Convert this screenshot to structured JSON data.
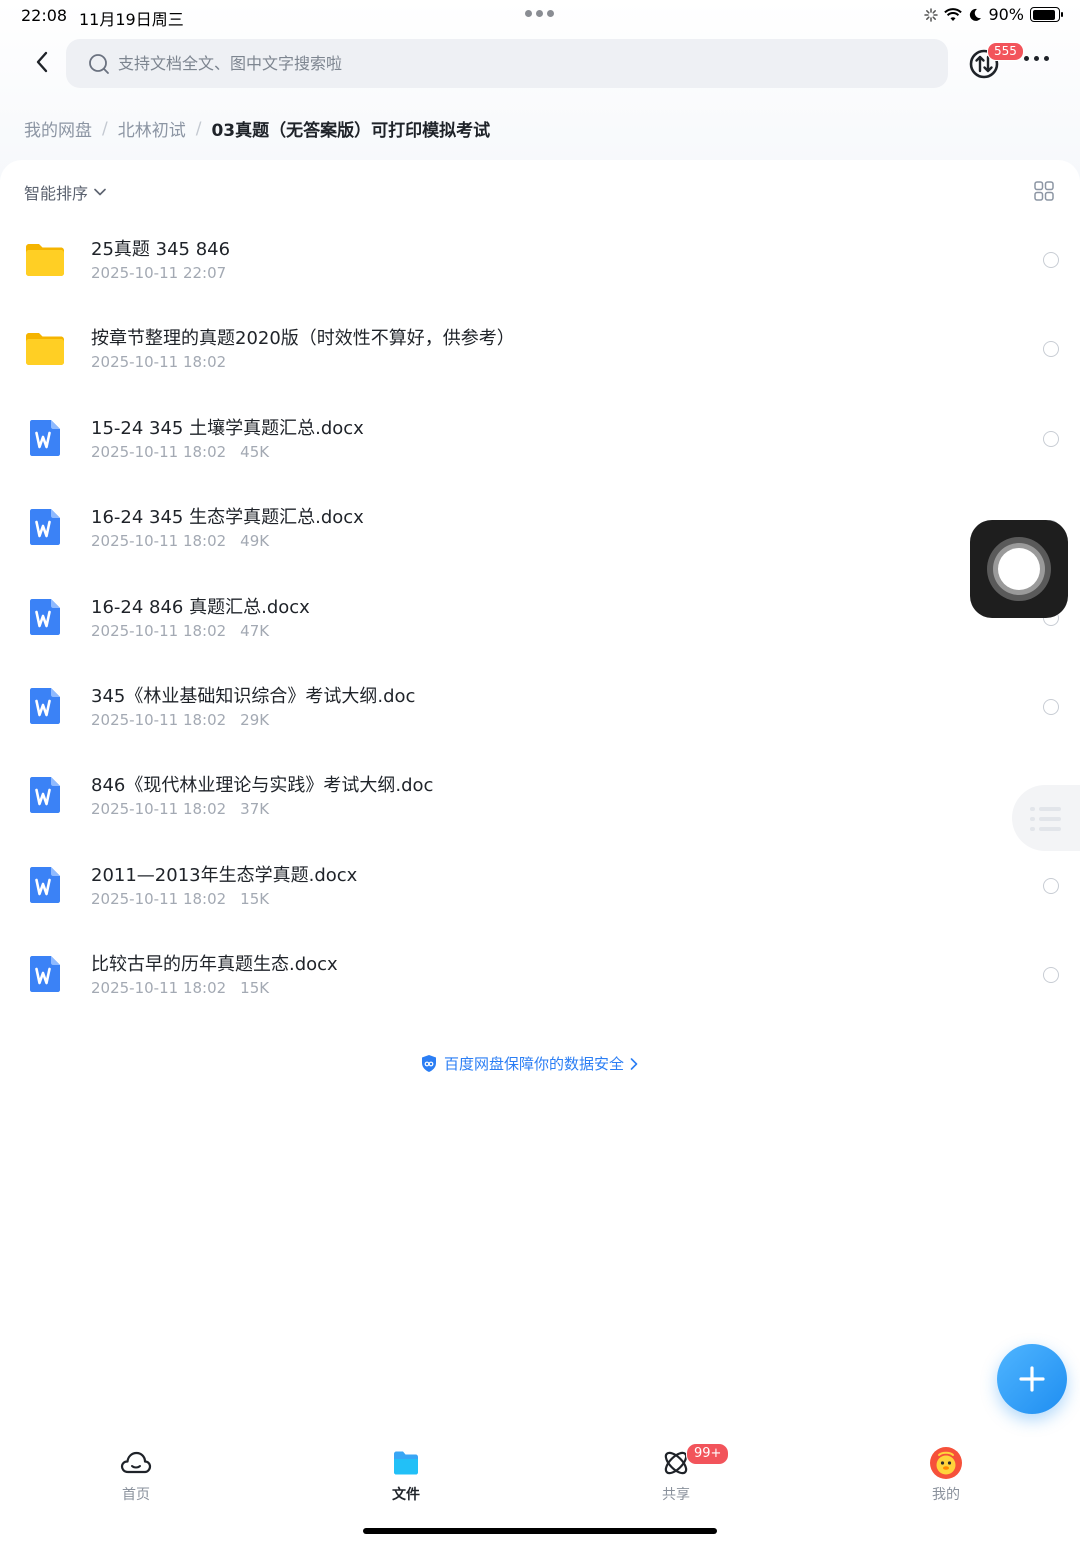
{
  "status_bar": {
    "time": "22:08",
    "date": "11月19日周三",
    "battery": "90%",
    "battery_level": 0.9
  },
  "header": {
    "search_placeholder": "支持文档全文、图中文字搜索啦",
    "transfer_badge": "555"
  },
  "breadcrumb": {
    "items": [
      "我的网盘",
      "北林初试"
    ],
    "separator": "/",
    "current": "03真题（无答案版）可打印模拟考试"
  },
  "toolbar": {
    "sort_label": "智能排序"
  },
  "files": [
    {
      "type": "folder",
      "name": "25真题 345 846",
      "date": "2025-10-11 22:07",
      "size": ""
    },
    {
      "type": "folder",
      "name": "按章节整理的真题2020版（时效性不算好，供参考）",
      "date": "2025-10-11 18:02",
      "size": ""
    },
    {
      "type": "word",
      "name": "15-24 345 土壤学真题汇总.docx",
      "date": "2025-10-11 18:02",
      "size": "45K"
    },
    {
      "type": "word",
      "name": "16-24 345  生态学真题汇总.docx",
      "date": "2025-10-11 18:02",
      "size": "49K"
    },
    {
      "type": "word",
      "name": "16-24 846 真题汇总.docx",
      "date": "2025-10-11 18:02",
      "size": "47K"
    },
    {
      "type": "word",
      "name": "345《林业基础知识综合》考试大纲.doc",
      "date": "2025-10-11 18:02",
      "size": "29K"
    },
    {
      "type": "word",
      "name": "846《现代林业理论与实践》考试大纲.doc",
      "date": "2025-10-11 18:02",
      "size": "37K"
    },
    {
      "type": "word",
      "name": "2011—2013年生态学真题.docx",
      "date": "2025-10-11 18:02",
      "size": "15K"
    },
    {
      "type": "word",
      "name": "比较古早的历年真题生态.docx",
      "date": "2025-10-11 18:02",
      "size": "15K"
    }
  ],
  "footer_link": "百度网盘保障你的数据安全",
  "bottom_nav": {
    "items": [
      {
        "label": "首页",
        "icon": "cloud-icon"
      },
      {
        "label": "文件",
        "icon": "folder-icon"
      },
      {
        "label": "共享",
        "icon": "share-icon"
      },
      {
        "label": "我的",
        "icon": "avatar-icon"
      }
    ],
    "active": 1,
    "share_badge": "99+"
  },
  "colors": {
    "accent": "#2b7ef4",
    "badge": "#f2545b",
    "folder": "#ffc51c",
    "word": "#3b82f6"
  }
}
